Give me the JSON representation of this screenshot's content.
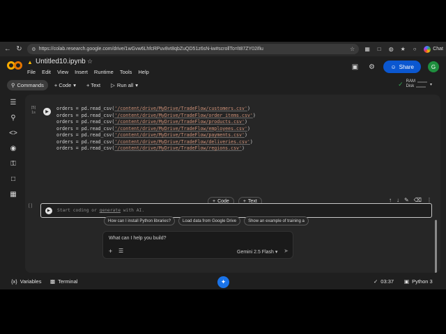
{
  "browser": {
    "url": "https://colab.research.google.com/drive/1wGvw6LhfcRPuv8vt8qbZuQD51z6sN-iw#scrollTo=lt87ZY02ifiu",
    "chat_label": "Chat"
  },
  "header": {
    "notebook_title": "Untitled10.ipynb",
    "menu": [
      "File",
      "Edit",
      "View",
      "Insert",
      "Runtime",
      "Tools",
      "Help"
    ],
    "share_label": "Share",
    "avatar_letter": "G"
  },
  "toolbar": {
    "commands_label": "Commands",
    "add_code_label": "+ Code",
    "add_text_label": "+ Text",
    "run_all_label": "Run all",
    "ram_label": "RAM",
    "disk_label": "Disk"
  },
  "code_cell": {
    "exec_count": "[5]",
    "exec_time": "1s",
    "lines": [
      {
        "prefix": "orders = pd.read_csv(",
        "path": "'/content/drive/MyDrive/TradeFlow/customers.csv'",
        "suffix": ")"
      },
      {
        "prefix": "orders = pd.read_csv(",
        "path": "'/content/drive/MyDrive/TradeFlow/order_items.csv'",
        "suffix": ")"
      },
      {
        "prefix": "orders = pd.read_csv(",
        "path": "'/content/drive/MyDrive/TradeFlow/products.csv'",
        "suffix": ")"
      },
      {
        "prefix": "orders = pd.read_csv(",
        "path": "'/content/drive/MyDrive/TradeFlow/employees.csv'",
        "suffix": ")"
      },
      {
        "prefix": "orders = pd.read_csv(",
        "path": "'/content/drive/MyDrive/TradeFlow/payments.csv'",
        "suffix": ")"
      },
      {
        "prefix": "orders = pd.read_csv(",
        "path": "'/content/drive/MyDrive/TradeFlow/deliveries.csv'",
        "suffix": ")"
      },
      {
        "prefix": "orders = pd.read_csv(",
        "path": "'/content/drive/MyDrive/TradeFlow/regions.csv'",
        "suffix": ")"
      }
    ]
  },
  "insert_bar": {
    "code_label": "Code",
    "text_label": "Text"
  },
  "empty_cell": {
    "exec_count": "[ ]",
    "placeholder_start": "Start coding or ",
    "placeholder_link": "generate",
    "placeholder_end": " with AI."
  },
  "ai_panel": {
    "suggestions": [
      "How can I install Python libraries?",
      "Load data from Google Drive",
      "Show an example of training a"
    ],
    "prompt_placeholder": "What can I help you build?",
    "model_label": "Gemini 2.5 Flash"
  },
  "statusbar": {
    "variables_label": "Variables",
    "terminal_label": "Terminal",
    "time": "03:37",
    "kernel": "Python 3"
  }
}
